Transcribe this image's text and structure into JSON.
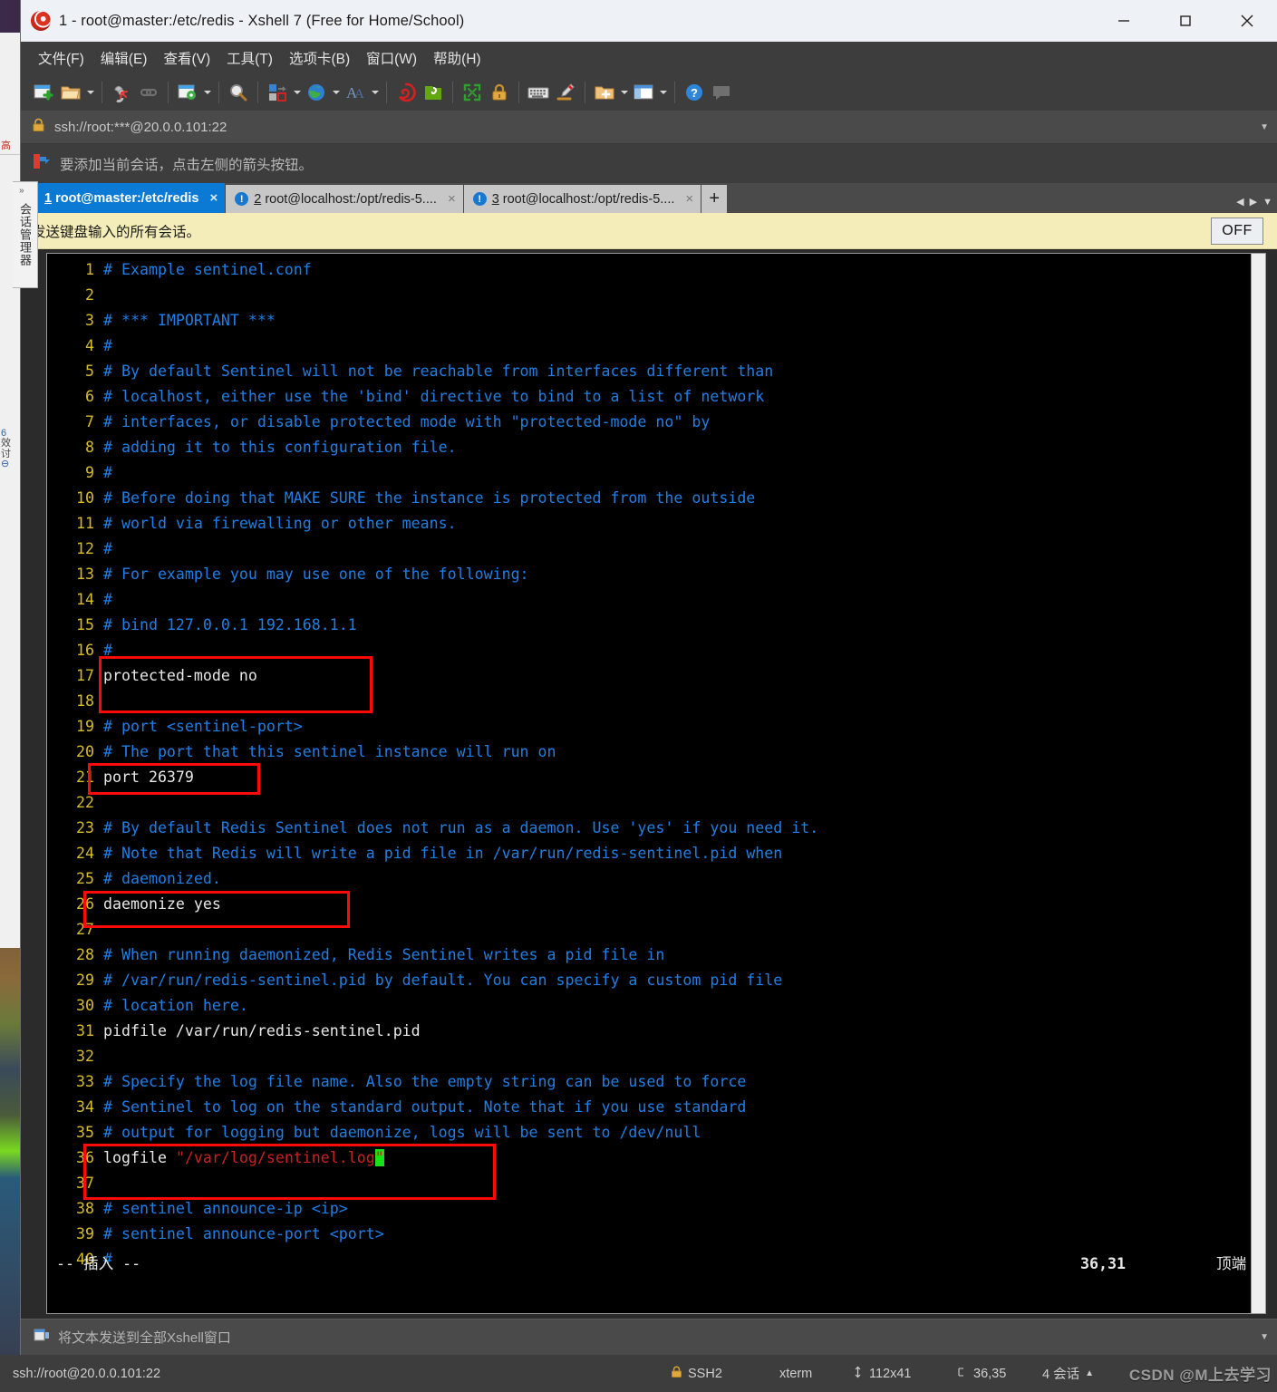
{
  "window": {
    "title": "1 - root@master:/etc/redis - Xshell 7 (Free for Home/School)",
    "minimize_label": "—",
    "maximize_label": "□",
    "close_label": "✕",
    "logo_icon": "xshell-logo-icon"
  },
  "menubar": {
    "items": [
      {
        "label": "文件(F)"
      },
      {
        "label": "编辑(E)"
      },
      {
        "label": "查看(V)"
      },
      {
        "label": "工具(T)"
      },
      {
        "label": "选项卡(B)"
      },
      {
        "label": "窗口(W)"
      },
      {
        "label": "帮助(H)"
      }
    ]
  },
  "toolbar": {
    "icons": [
      "new-session-icon",
      "open-folder-icon",
      "disconnect-icon",
      "link-icon",
      "session-properties-icon",
      "find-icon",
      "transfer-icon",
      "globe-icon",
      "font-icon",
      "xshell-icon",
      "xftp-icon",
      "fullscreen-icon",
      "lock-icon",
      "keyboard-icon",
      "highlight-pen-icon",
      "add-panel-icon",
      "layout-icon",
      "help-icon",
      "comment-icon"
    ]
  },
  "address_bar": {
    "lock_icon": "lock-icon",
    "url": "ssh://root:***@20.0.0.101:22",
    "dropdown_icon": "chevron-down-icon"
  },
  "hint_bar": {
    "icon": "red-arrow-icon",
    "text": "要添加当前会话，点击左侧的箭头按钮。"
  },
  "tabs": {
    "items": [
      {
        "num": "1",
        "title": "root@master:/etc/redis",
        "active": true,
        "status_icon": "green-dot-icon",
        "close_label": "×"
      },
      {
        "num": "2",
        "title": "root@localhost:/opt/redis-5....",
        "active": false,
        "status_icon": "warning-icon",
        "close_label": "×"
      },
      {
        "num": "3",
        "title": "root@localhost:/opt/redis-5....",
        "active": false,
        "status_icon": "warning-icon",
        "close_label": "×"
      }
    ],
    "add_label": "+",
    "nav_prev_icon": "chevron-left-icon",
    "nav_next_icon": "chevron-right-icon",
    "nav_menu_icon": "chevron-down-icon"
  },
  "broadcast_bar": {
    "text": "发送键盘输入的所有会话。",
    "toggle_label": "OFF"
  },
  "sidebar_vertical_tab": {
    "label": "会话管理器",
    "expand_icon": "chevron-right-icon"
  },
  "terminal": {
    "lines": [
      {
        "n": "1",
        "segs": [
          {
            "t": "# Example sentinel.conf",
            "c": "cmt"
          }
        ]
      },
      {
        "n": "2",
        "segs": []
      },
      {
        "n": "3",
        "segs": [
          {
            "t": "# *** IMPORTANT ***",
            "c": "cmt"
          }
        ]
      },
      {
        "n": "4",
        "segs": [
          {
            "t": "#",
            "c": "cmt"
          }
        ]
      },
      {
        "n": "5",
        "segs": [
          {
            "t": "# By default Sentinel will not be reachable from interfaces different than",
            "c": "cmt"
          }
        ]
      },
      {
        "n": "6",
        "segs": [
          {
            "t": "# localhost, either use the 'bind' directive to bind to a list of network",
            "c": "cmt"
          }
        ]
      },
      {
        "n": "7",
        "segs": [
          {
            "t": "# interfaces, or disable protected mode with \"protected-mode no\" by",
            "c": "cmt"
          }
        ]
      },
      {
        "n": "8",
        "segs": [
          {
            "t": "# adding it to this configuration file.",
            "c": "cmt"
          }
        ]
      },
      {
        "n": "9",
        "segs": [
          {
            "t": "#",
            "c": "cmt"
          }
        ]
      },
      {
        "n": "10",
        "segs": [
          {
            "t": "# Before doing that MAKE SURE the instance is protected from the outside",
            "c": "cmt"
          }
        ]
      },
      {
        "n": "11",
        "segs": [
          {
            "t": "# world via firewalling or other means.",
            "c": "cmt"
          }
        ]
      },
      {
        "n": "12",
        "segs": [
          {
            "t": "#",
            "c": "cmt"
          }
        ]
      },
      {
        "n": "13",
        "segs": [
          {
            "t": "# For example you may use one of the following:",
            "c": "cmt"
          }
        ]
      },
      {
        "n": "14",
        "segs": [
          {
            "t": "#",
            "c": "cmt"
          }
        ]
      },
      {
        "n": "15",
        "segs": [
          {
            "t": "# bind 127.0.0.1 192.168.1.1",
            "c": "cmt"
          }
        ]
      },
      {
        "n": "16",
        "segs": [
          {
            "t": "#",
            "c": "cmt"
          }
        ]
      },
      {
        "n": "17",
        "segs": [
          {
            "t": "protected-mode no",
            "c": "plain"
          }
        ]
      },
      {
        "n": "18",
        "segs": []
      },
      {
        "n": "19",
        "segs": [
          {
            "t": "# port <sentinel-port>",
            "c": "cmt"
          }
        ]
      },
      {
        "n": "20",
        "segs": [
          {
            "t": "# The port that this sentinel instance will run on",
            "c": "cmt"
          }
        ]
      },
      {
        "n": "21",
        "segs": [
          {
            "t": "port 26379",
            "c": "plain"
          }
        ]
      },
      {
        "n": "22",
        "segs": []
      },
      {
        "n": "23",
        "segs": [
          {
            "t": "# By default Redis Sentinel does not run as a daemon. Use 'yes' if you need it.",
            "c": "cmt"
          }
        ]
      },
      {
        "n": "24",
        "segs": [
          {
            "t": "# Note that Redis will write a pid file in /var/run/redis-sentinel.pid when",
            "c": "cmt"
          }
        ]
      },
      {
        "n": "25",
        "segs": [
          {
            "t": "# daemonized.",
            "c": "cmt"
          }
        ]
      },
      {
        "n": "26",
        "segs": [
          {
            "t": "daemonize yes",
            "c": "plain"
          }
        ]
      },
      {
        "n": "27",
        "segs": []
      },
      {
        "n": "28",
        "segs": [
          {
            "t": "# When running daemonized, Redis Sentinel writes a pid file in",
            "c": "cmt"
          }
        ]
      },
      {
        "n": "29",
        "segs": [
          {
            "t": "# /var/run/redis-sentinel.pid by default. You can specify a custom pid file",
            "c": "cmt"
          }
        ]
      },
      {
        "n": "30",
        "segs": [
          {
            "t": "# location here.",
            "c": "cmt"
          }
        ]
      },
      {
        "n": "31",
        "segs": [
          {
            "t": "pidfile /var/run/redis-sentinel.pid",
            "c": "plain"
          }
        ]
      },
      {
        "n": "32",
        "segs": []
      },
      {
        "n": "33",
        "segs": [
          {
            "t": "# Specify the log file name. Also the empty string can be used to force",
            "c": "cmt"
          }
        ]
      },
      {
        "n": "34",
        "segs": [
          {
            "t": "# Sentinel to log on the standard output. Note that if you use standard",
            "c": "cmt"
          }
        ]
      },
      {
        "n": "35",
        "segs": [
          {
            "t": "# output for logging but daemonize, logs will be sent to /dev/null",
            "c": "cmt"
          }
        ]
      },
      {
        "n": "36",
        "segs": [
          {
            "t": "logfile ",
            "c": "plain"
          },
          {
            "t": "\"/var/log/sentinel.log",
            "c": "str"
          },
          {
            "t": "\"",
            "c": "cursor"
          }
        ]
      },
      {
        "n": "37",
        "segs": []
      },
      {
        "n": "38",
        "segs": [
          {
            "t": "# sentinel announce-ip <ip>",
            "c": "cmt"
          }
        ]
      },
      {
        "n": "39",
        "segs": [
          {
            "t": "# sentinel announce-port <port>",
            "c": "cmt"
          }
        ]
      },
      {
        "n": "40",
        "segs": [
          {
            "t": "#",
            "c": "cmt"
          }
        ]
      }
    ],
    "vim_mode": "-- 插入 --",
    "vim_position": "36,31",
    "vim_scroll": "顶端",
    "highlight_color": "#fb0a0a"
  },
  "send_bar": {
    "icon": "send-to-all-icon",
    "placeholder": "将文本发送到全部Xshell窗口",
    "dropdown_icon": "chevron-down-icon"
  },
  "status_bar": {
    "url": "ssh://root@20.0.0.101:22",
    "protocol": "SSH2",
    "protocol_icon": "lock-icon",
    "terminal_type": "xterm",
    "size": "112x41",
    "size_icon": "resize-icon",
    "cursor": "36,35",
    "cursor_icon": "cursor-icon",
    "sessions": "4 会话",
    "sessions_icon": "chevron-up-icon",
    "watermark": "CSDN @M上去学习"
  },
  "left_panel_peek": {
    "lines": [
      "高",
      "6",
      "效",
      "讨",
      "⊖"
    ]
  },
  "colors": {
    "accent_blue": "#0a7ad4",
    "comment_blue": "#1f7fe8",
    "line_number": "#d7bd2b",
    "string_red": "#cc2020",
    "cursor_green": "#19e019",
    "annotation_red": "#fb0a0a",
    "broadcast_yellow": "#f5edb9"
  }
}
